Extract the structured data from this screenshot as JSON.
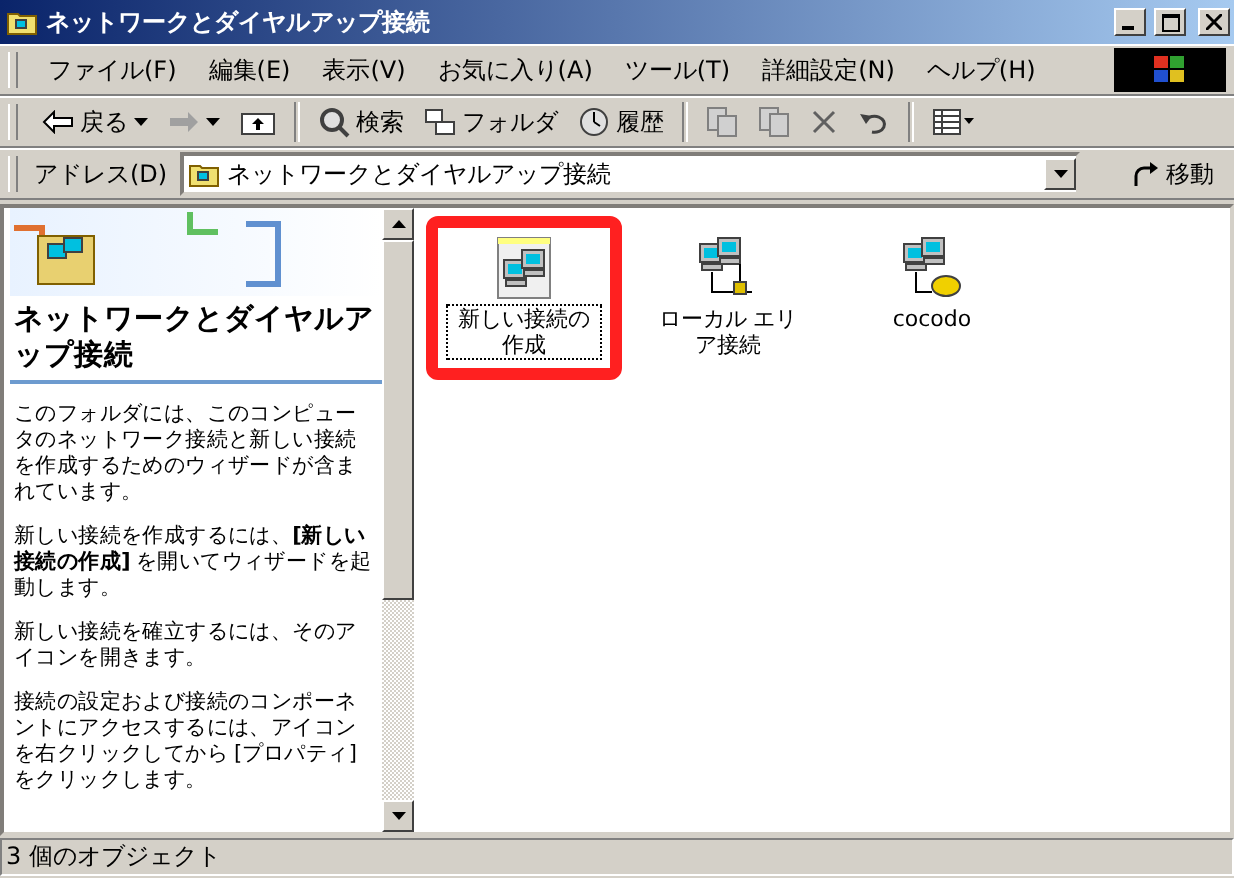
{
  "window": {
    "title": "ネットワークとダイヤルアップ接続"
  },
  "menu": [
    "ファイル(F)",
    "編集(E)",
    "表示(V)",
    "お気に入り(A)",
    "ツール(T)",
    "詳細設定(N)",
    "ヘルプ(H)"
  ],
  "toolbar": [
    {
      "kind": "back",
      "label": "戻る"
    },
    {
      "kind": "forward"
    },
    {
      "kind": "up"
    },
    {
      "kind": "search",
      "label": "検索"
    },
    {
      "kind": "folders",
      "label": "フォルダ"
    },
    {
      "kind": "history",
      "label": "履歴"
    },
    {
      "kind": "move"
    },
    {
      "kind": "copy"
    },
    {
      "kind": "delete"
    },
    {
      "kind": "undo"
    },
    {
      "kind": "views"
    }
  ],
  "address": {
    "label": "アドレス(D)",
    "value": "ネットワークとダイヤルアップ接続",
    "go": "移動"
  },
  "sidebar": {
    "title": "ネットワークとダイヤルアップ接続",
    "paragraphs": [
      "このフォルダには、このコンピュータのネットワーク接続と新しい接続を作成するためのウィザードが含まれています。",
      "新しい接続を作成するには、**[新しい接続の作成]** を開いてウィザードを起動します。",
      "新しい接続を確立するには、そのアイコンを開きます。",
      "接続の設定および接続のコンポーネントにアクセスするには、アイコンを右クリックしてから [プロパティ] をクリックします。"
    ]
  },
  "items": [
    {
      "kind": "wizard",
      "label": "新しい接続の作成",
      "selected": true,
      "highlighted": true
    },
    {
      "kind": "lan",
      "label": "ローカル エリア接続",
      "selected": false,
      "highlighted": false
    },
    {
      "kind": "dialup",
      "label": "cocodo",
      "selected": false,
      "highlighted": false
    }
  ],
  "status_bar": "3 個のオブジェクト"
}
